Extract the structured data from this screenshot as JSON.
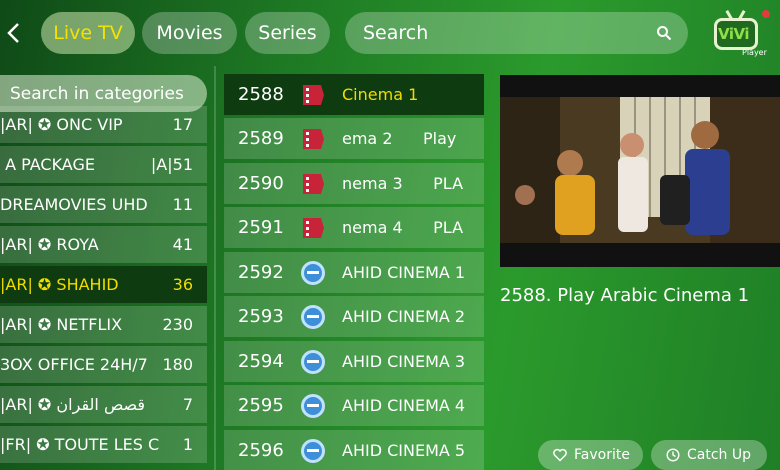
{
  "header": {
    "tabs": [
      {
        "label": "Live TV",
        "active": true
      },
      {
        "label": "Movies",
        "active": false
      },
      {
        "label": "Series",
        "active": false
      }
    ],
    "search_placeholder": "Search",
    "logo": {
      "brand": "ViVi",
      "subtitle": "Player"
    }
  },
  "categories": {
    "search_placeholder": "Search in categories",
    "items": [
      {
        "name": "|AR| ✪ ONC VIP",
        "count": "17"
      },
      {
        "name": " A PACKAGE",
        "count": "|A|51"
      },
      {
        "name": "DREAMOVIES UHD",
        "count": "11"
      },
      {
        "name": "|AR| ✪ ROYA",
        "count": "41"
      },
      {
        "name": "|AR| ✪ SHAHID",
        "count": "36",
        "active": true
      },
      {
        "name": "|AR| ✪ NETFLIX",
        "count": "230"
      },
      {
        "name": "3OX OFFICE 24H/7",
        "count": "180"
      },
      {
        "name": "|AR| ✪ قصص القران",
        "count": "7"
      },
      {
        "name": "|FR| ✪ TOUTE LES CHAI",
        "count": "1"
      }
    ]
  },
  "channels": [
    {
      "number": "2588",
      "name": "Cinema 1",
      "icon": "cinema-ticket-icon",
      "active": true
    },
    {
      "number": "2589",
      "name": "ema 2      Play",
      "icon": "cinema-ticket-icon"
    },
    {
      "number": "2590",
      "name": "nema 3      PLA",
      "icon": "cinema-ticket-icon"
    },
    {
      "number": "2591",
      "name": "nema 4      PLA",
      "icon": "cinema-ticket-icon"
    },
    {
      "number": "2592",
      "name": "AHID CINEMA 1",
      "icon": "shahid-vip-icon"
    },
    {
      "number": "2593",
      "name": "AHID CINEMA 2",
      "icon": "shahid-vip-icon"
    },
    {
      "number": "2594",
      "name": "AHID CINEMA 3",
      "icon": "shahid-vip-icon"
    },
    {
      "number": "2595",
      "name": "AHID CINEMA 4",
      "icon": "shahid-vip-icon"
    },
    {
      "number": "2596",
      "name": "AHID CINEMA 5",
      "icon": "shahid-vip-icon"
    }
  ],
  "preview": {
    "now_playing": "2588.  Play Arabic Cinema 1",
    "favorite_label": "Favorite",
    "catchup_label": "Catch Up"
  },
  "colors": {
    "accent_yellow": "#f2dc00",
    "active_row": "#0e3b10",
    "background_green": "#1e7a24"
  }
}
